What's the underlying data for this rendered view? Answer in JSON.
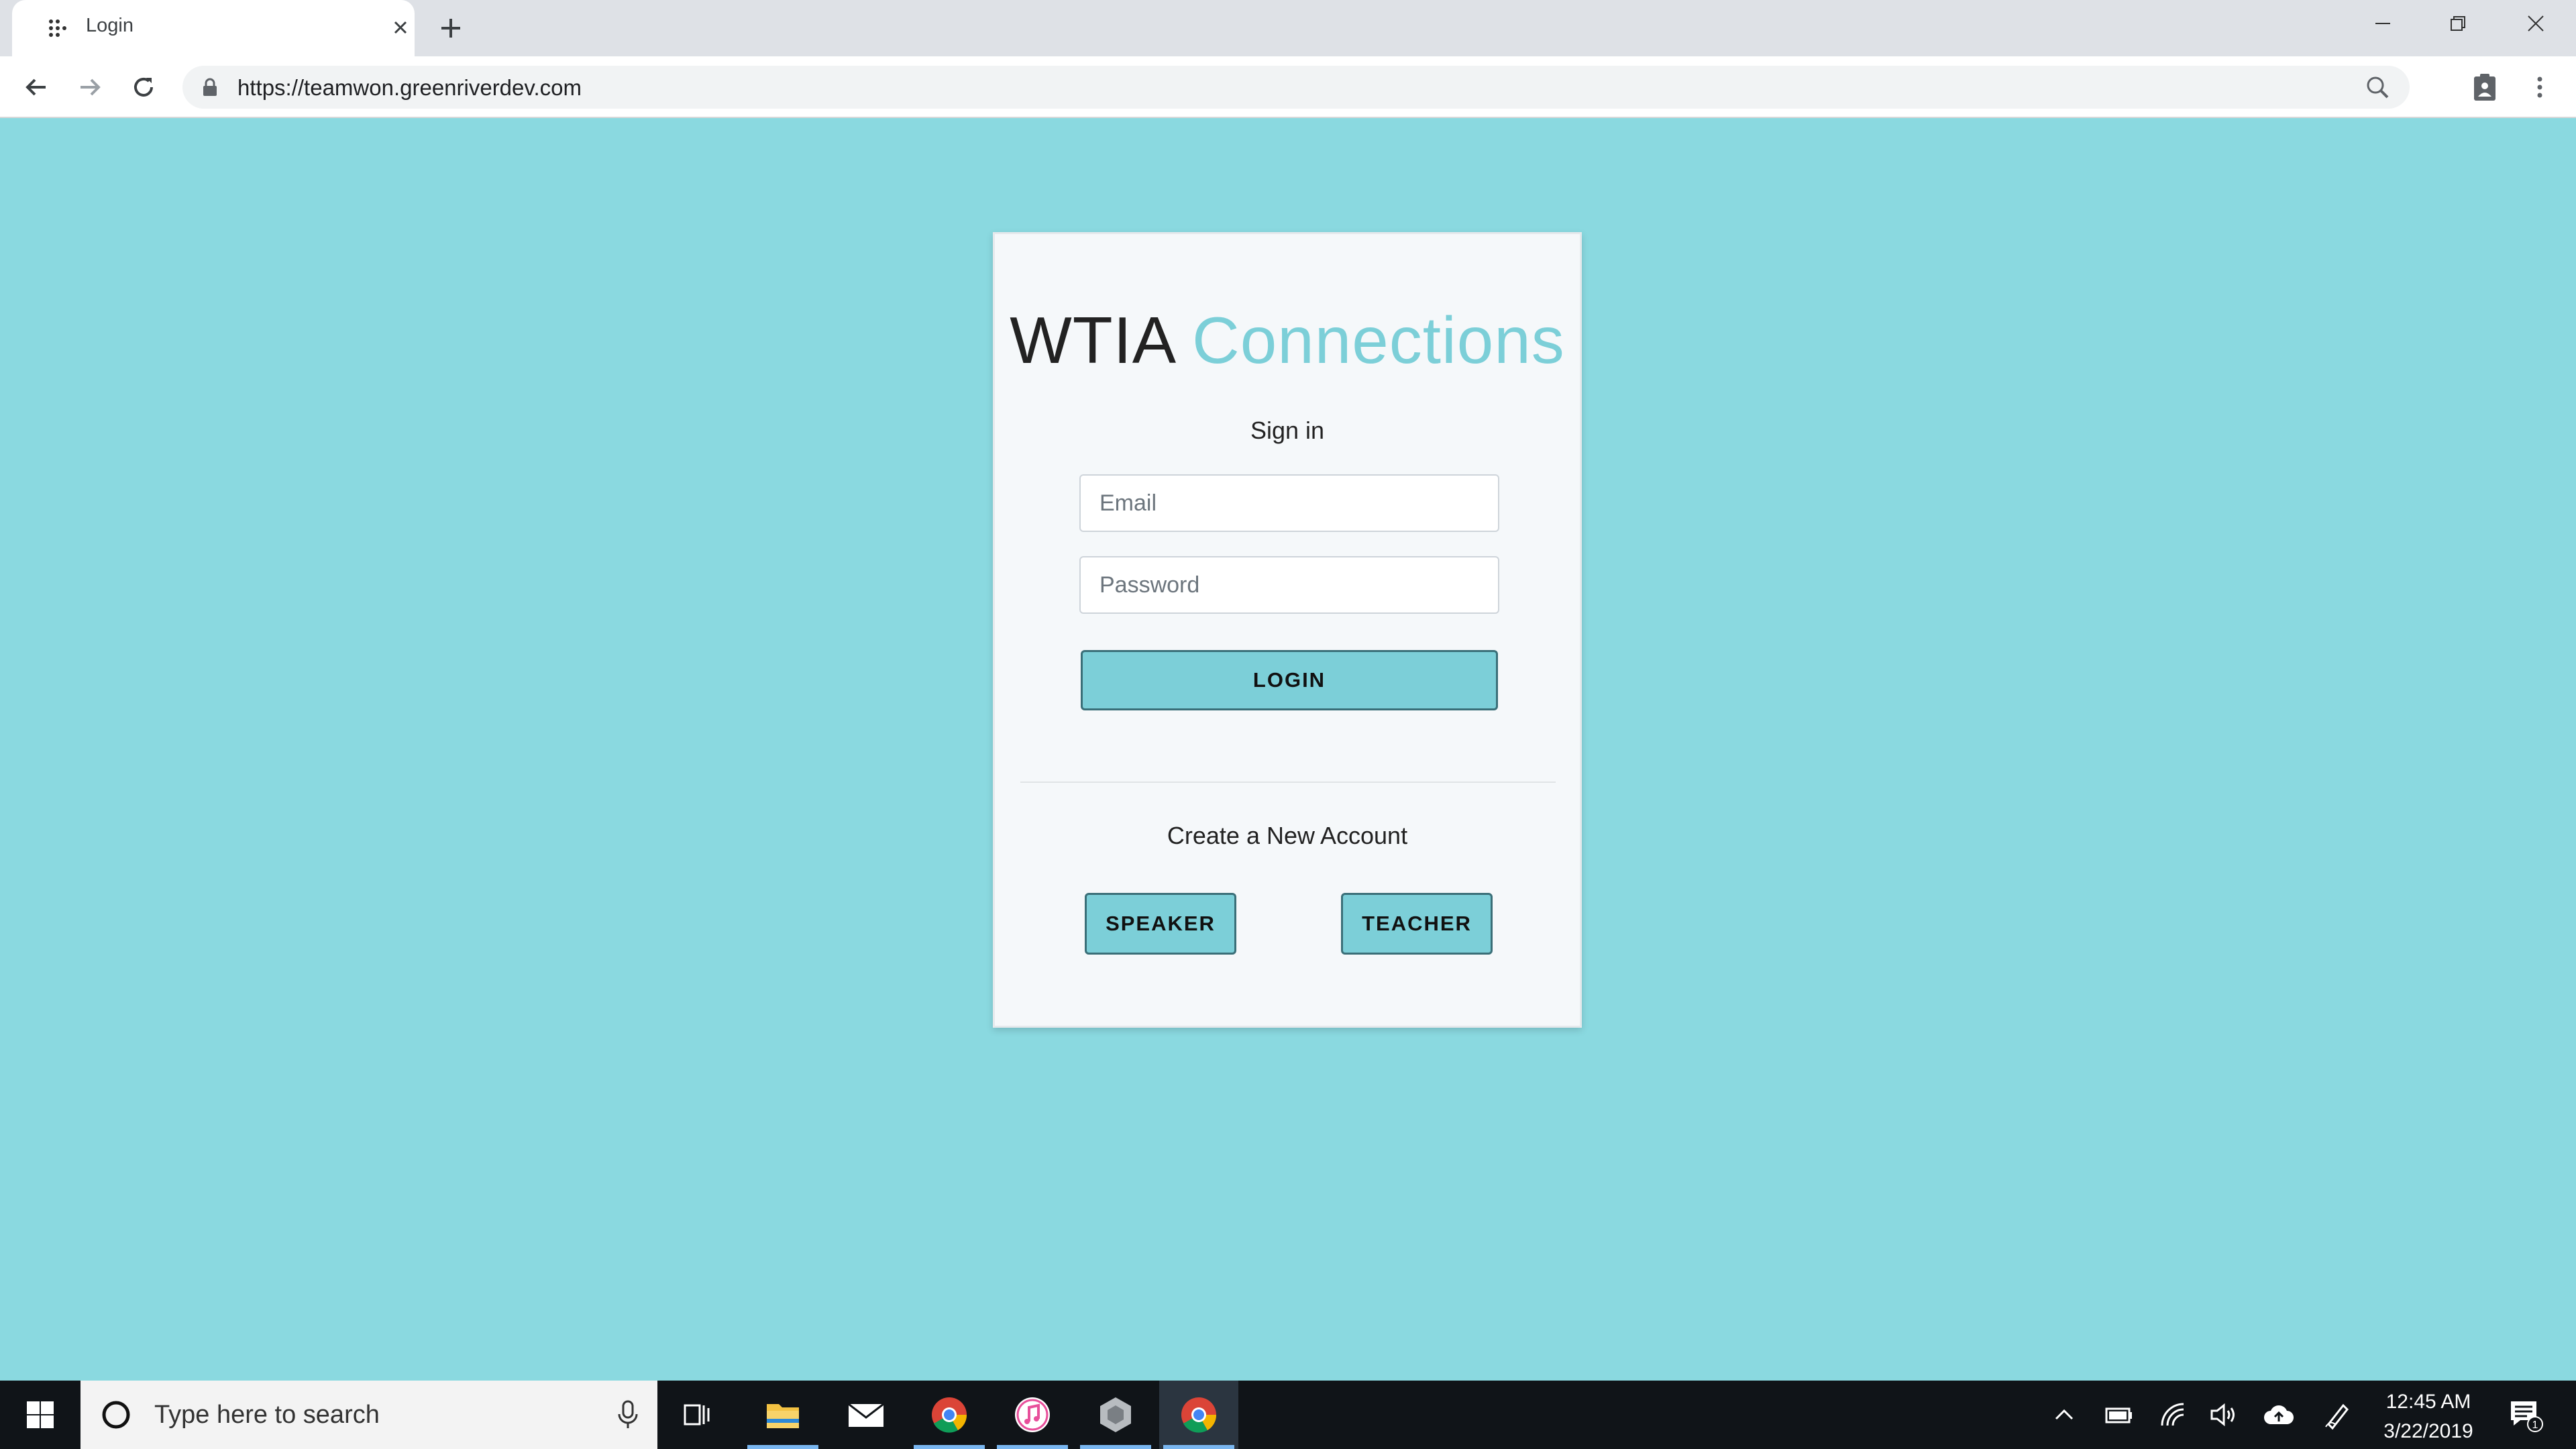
{
  "browser": {
    "tab_title": "Login",
    "url": "https://teamwon.greenriverdev.com",
    "icons": {
      "favicon": "dots-grid-icon",
      "tab_close": "close-icon",
      "new_tab": "plus-icon",
      "back": "arrow-left-icon",
      "forward": "arrow-right-icon",
      "reload": "reload-icon",
      "lock": "lock-icon",
      "zoom": "magnifier-icon",
      "extension": "clipboard-person-icon",
      "menu": "kebab-menu-icon"
    }
  },
  "page": {
    "brand_part1": "WTIA",
    "brand_part2": "Connections",
    "sign_in_heading": "Sign in",
    "email_placeholder": "Email",
    "password_placeholder": "Password",
    "login_button": "LOGIN",
    "create_heading": "Create a New Account",
    "speaker_button": "SPEAKER",
    "teacher_button": "TEACHER",
    "colors": {
      "background": "#8ad9e0",
      "accent": "#7ccfd8",
      "card": "#f5f8fa"
    }
  },
  "taskbar": {
    "search_placeholder": "Type here to search",
    "time": "12:45 AM",
    "date": "3/22/2019",
    "notification_count": "1",
    "apps": [
      "task-view-icon",
      "file-explorer-icon",
      "mail-icon",
      "chrome-icon",
      "itunes-icon",
      "app-icon",
      "chrome-icon"
    ]
  }
}
